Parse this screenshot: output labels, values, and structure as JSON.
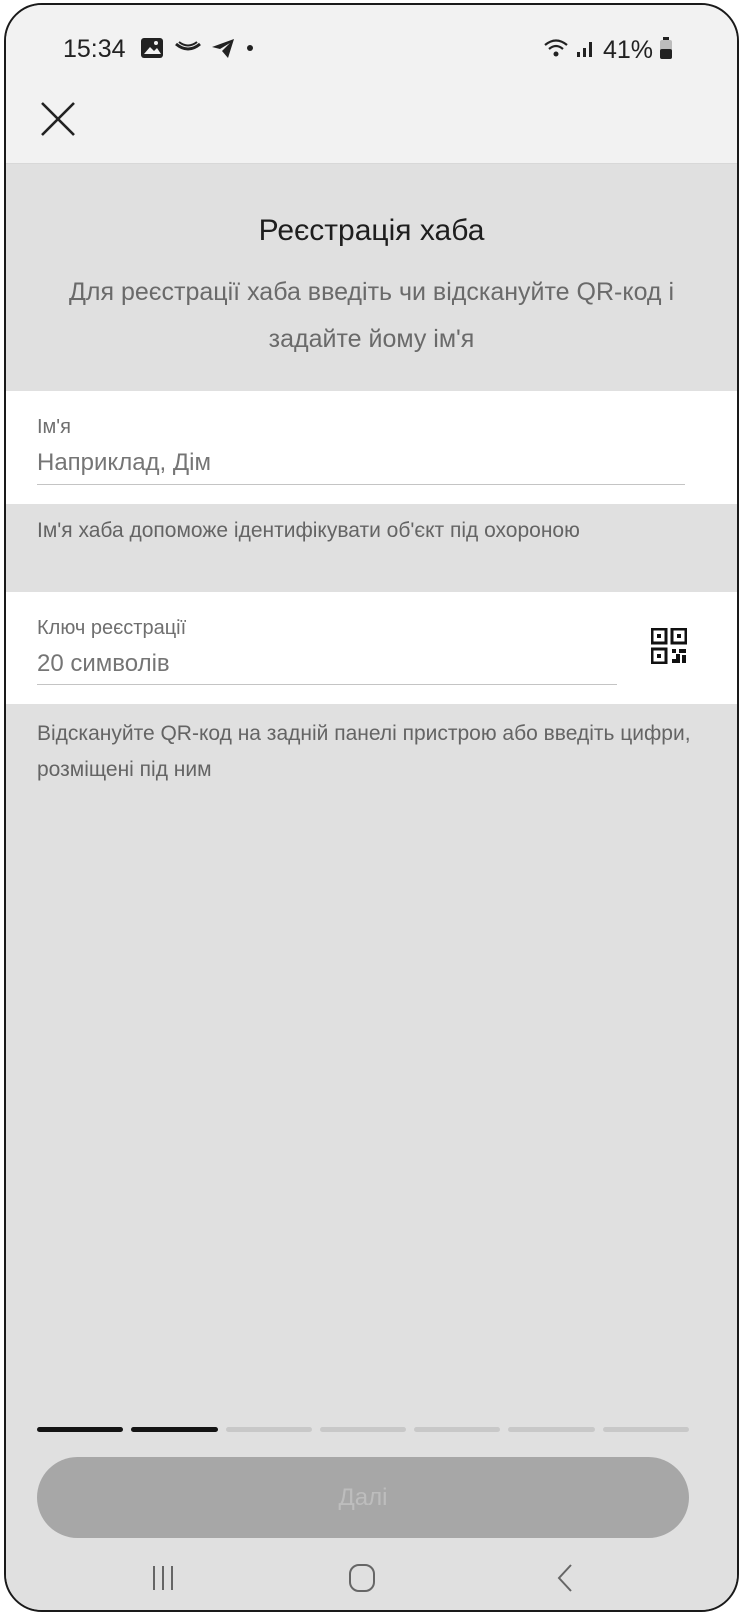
{
  "status_bar": {
    "time": "15:34",
    "battery": "41%",
    "left_icons": [
      "gallery-icon",
      "app-icon",
      "telegram-icon",
      "dot-icon"
    ],
    "right_icons": [
      "wifi-icon",
      "signal-icon",
      "battery-icon"
    ]
  },
  "header": {
    "close_icon": "close-icon"
  },
  "page": {
    "title": "Реєстрація хаба",
    "subtitle": "Для реєстрації хаба введіть чи відскануйте QR-код і задайте йому ім'я"
  },
  "name_field": {
    "label": "Ім'я",
    "placeholder": "Наприклад, Дім",
    "value": "",
    "hint": "Ім'я хаба допоможе ідентифікувати об'єкт під охороною"
  },
  "key_field": {
    "label": "Ключ реєстрації",
    "placeholder": "20 символів",
    "value": "",
    "hint": "Відскануйте QR-код на задній панелі пристрою або введіть цифри, розміщені під ним",
    "scan_icon": "qr-code-icon"
  },
  "progress": {
    "total_steps": 7,
    "completed_steps": 2
  },
  "footer": {
    "next_label": "Далі",
    "next_enabled": false
  },
  "colors": {
    "background": "#e0e0e0",
    "field_background": "#ffffff",
    "button_disabled": "#a7a7a7",
    "progress_active": "#141414",
    "progress_inactive": "#c8c8c8"
  }
}
